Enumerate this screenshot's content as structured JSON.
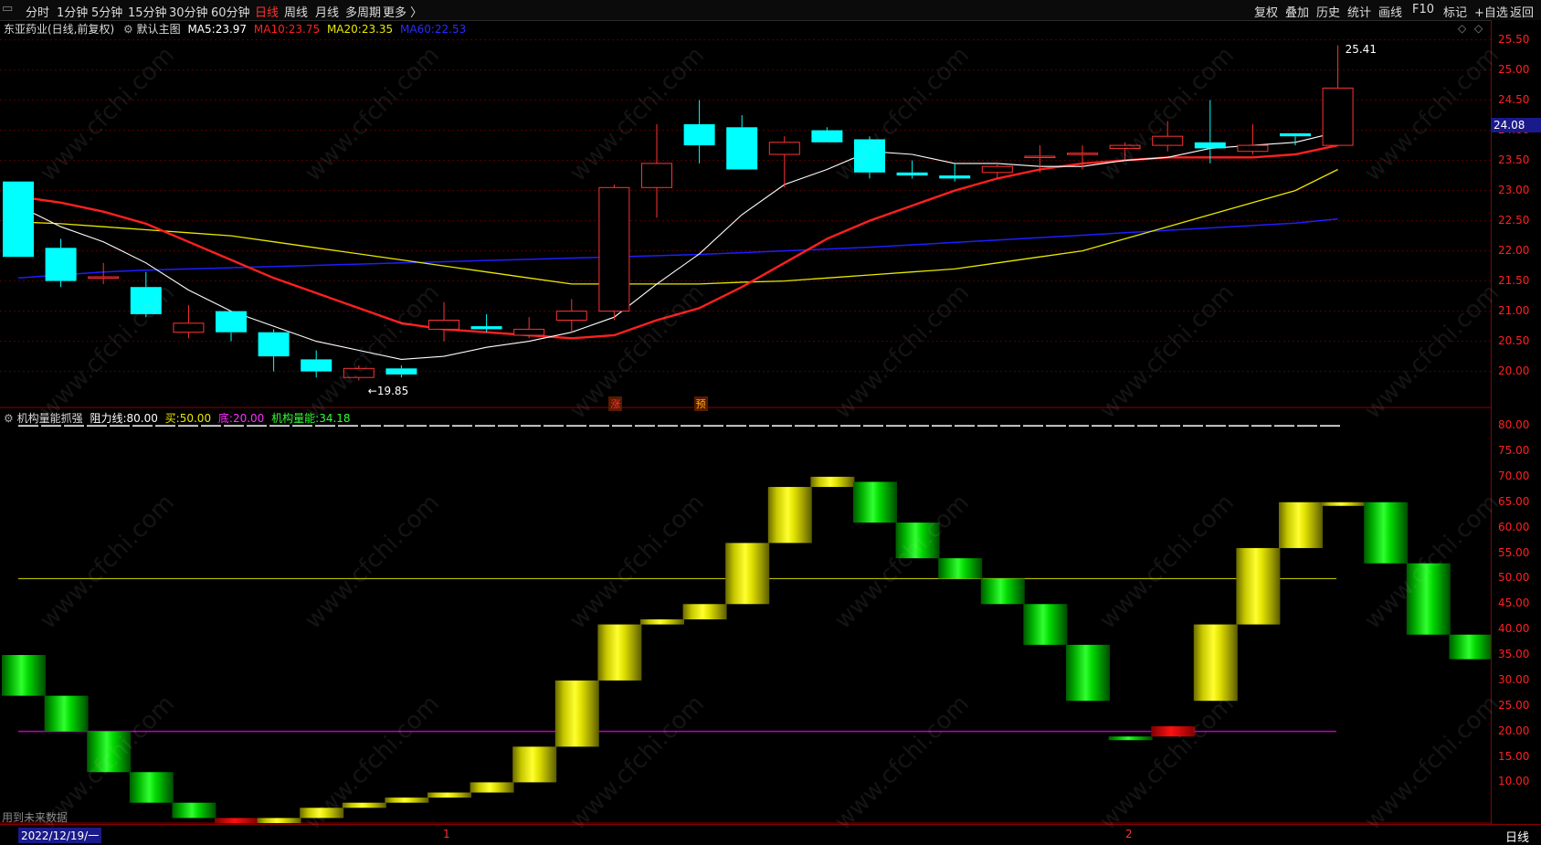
{
  "toolbar": {
    "left": [
      "分时",
      "1分钟",
      "5分钟",
      "15分钟",
      "30分钟",
      "60分钟",
      "日线",
      "周线",
      "月线",
      "多周期",
      "更多 〉"
    ],
    "active_index": 6,
    "right": [
      "复权",
      "叠加",
      "历史",
      "统计",
      "画线",
      "F10",
      "标记",
      "+自选",
      "返回"
    ]
  },
  "main_info": {
    "stock": "东亚药业(日线,前复权)",
    "chart_name": "默认主图",
    "ma5_label": "MA5:",
    "ma5_value": "23.97",
    "ma10_label": "MA10:",
    "ma10_value": "23.75",
    "ma20_label": "MA20:",
    "ma20_value": "23.35",
    "ma60_label": "MA60:",
    "ma60_value": "22.53"
  },
  "indicator_info": {
    "name": "机构量能抓强",
    "resist_label": "阻力线:",
    "resist_value": "80.00",
    "buy_label": "买:",
    "buy_value": "50.00",
    "bottom_label": "底:",
    "bottom_value": "20.00",
    "energy_label": "机构量能:",
    "energy_value": "34.18"
  },
  "price_ticks": [
    "25.50",
    "25.00",
    "24.50",
    "24.00",
    "23.50",
    "23.00",
    "22.50",
    "22.00",
    "21.50",
    "21.00",
    "20.50",
    "20.00"
  ],
  "indicator_ticks": [
    "80.00",
    "75.00",
    "70.00",
    "65.00",
    "60.00",
    "55.00",
    "50.00",
    "45.00",
    "40.00",
    "35.00",
    "30.00",
    "25.00",
    "20.00",
    "15.00",
    "10.00"
  ],
  "current_price": "24.08",
  "high_label": "25.41",
  "low_label": "←19.85",
  "markers": {
    "zhang": "涨",
    "yu": "预"
  },
  "bottom_note": "用到未来数据",
  "date_label": "2022/12/19/一",
  "month_marks": [
    "1",
    "2"
  ],
  "period_label": "日线",
  "watermark": "www.cfchi.com",
  "colors": {
    "up": "#ff3232",
    "down": "#00ffff",
    "ma5": "#ffffff",
    "ma10": "#ff2020",
    "ma20": "#e8e800",
    "ma60": "#1e1eff",
    "border": "#8b0000"
  },
  "chart_data": [
    {
      "type": "candlestick",
      "title": "东亚药业(日线,前复权)",
      "series": [
        {
          "open": 23.15,
          "close": 21.9,
          "high": 23.15,
          "low": 21.9
        },
        {
          "open": 22.05,
          "close": 21.5,
          "high": 22.2,
          "low": 21.4
        },
        {
          "open": 21.57,
          "close": 21.57,
          "high": 21.8,
          "low": 21.45
        },
        {
          "open": 21.4,
          "close": 20.95,
          "high": 21.65,
          "low": 20.9
        },
        {
          "open": 20.65,
          "close": 20.8,
          "high": 21.1,
          "low": 20.55
        },
        {
          "open": 21.0,
          "close": 20.65,
          "high": 21.0,
          "low": 20.5
        },
        {
          "open": 20.65,
          "close": 20.25,
          "high": 20.7,
          "low": 20.0
        },
        {
          "open": 20.2,
          "close": 20.0,
          "high": 20.35,
          "low": 19.9
        },
        {
          "open": 19.9,
          "close": 20.05,
          "high": 20.1,
          "low": 19.85
        },
        {
          "open": 20.05,
          "close": 19.95,
          "high": 20.1,
          "low": 19.9
        },
        {
          "open": 20.7,
          "close": 20.85,
          "high": 21.15,
          "low": 20.5
        },
        {
          "open": 20.75,
          "close": 20.7,
          "high": 20.95,
          "low": 20.65
        },
        {
          "open": 20.6,
          "close": 20.7,
          "high": 20.9,
          "low": 20.55
        },
        {
          "open": 20.85,
          "close": 21.0,
          "high": 21.2,
          "low": 20.65
        },
        {
          "open": 21.0,
          "close": 23.05,
          "high": 23.1,
          "low": 20.85
        },
        {
          "open": 23.05,
          "close": 23.45,
          "high": 24.1,
          "low": 22.55
        },
        {
          "open": 24.1,
          "close": 23.75,
          "high": 24.5,
          "low": 23.45
        },
        {
          "open": 24.05,
          "close": 23.35,
          "high": 24.25,
          "low": 23.35
        },
        {
          "open": 23.6,
          "close": 23.8,
          "high": 23.9,
          "low": 23.05
        },
        {
          "open": 24.0,
          "close": 23.8,
          "high": 24.05,
          "low": 23.8
        },
        {
          "open": 23.85,
          "close": 23.3,
          "high": 23.9,
          "low": 23.2
        },
        {
          "open": 23.3,
          "close": 23.25,
          "high": 23.5,
          "low": 23.2
        },
        {
          "open": 23.25,
          "close": 23.2,
          "high": 23.45,
          "low": 23.15
        },
        {
          "open": 23.3,
          "close": 23.4,
          "high": 23.45,
          "low": 23.2
        },
        {
          "open": 23.55,
          "close": 23.57,
          "high": 23.75,
          "low": 23.3
        },
        {
          "open": 23.6,
          "close": 23.62,
          "high": 23.75,
          "low": 23.35
        },
        {
          "open": 23.7,
          "close": 23.75,
          "high": 23.8,
          "low": 23.5
        },
        {
          "open": 23.75,
          "close": 23.9,
          "high": 24.15,
          "low": 23.65
        },
        {
          "open": 23.8,
          "close": 23.7,
          "high": 24.5,
          "low": 23.45
        },
        {
          "open": 23.65,
          "close": 23.75,
          "high": 24.1,
          "low": 23.6
        },
        {
          "open": 23.95,
          "close": 23.9,
          "high": 23.95,
          "low": 23.75
        },
        {
          "open": 23.75,
          "close": 24.7,
          "high": 25.41,
          "low": 23.75
        }
      ],
      "ma5": [
        22.75,
        22.4,
        22.15,
        21.8,
        21.35,
        21.0,
        20.75,
        20.5,
        20.35,
        20.2,
        20.25,
        20.4,
        20.5,
        20.65,
        20.9,
        21.45,
        21.95,
        22.6,
        23.1,
        23.35,
        23.65,
        23.6,
        23.45,
        23.45,
        23.4,
        23.4,
        23.5,
        23.55,
        23.7,
        23.75,
        23.8,
        23.97
      ],
      "ma10": [
        22.9,
        22.8,
        22.65,
        22.45,
        22.15,
        21.85,
        21.55,
        21.3,
        21.05,
        20.8,
        20.7,
        20.65,
        20.6,
        20.55,
        20.6,
        20.85,
        21.05,
        21.4,
        21.8,
        22.2,
        22.5,
        22.75,
        23.0,
        23.2,
        23.35,
        23.45,
        23.5,
        23.55,
        23.55,
        23.55,
        23.6,
        23.75
      ],
      "ma20": [
        22.48,
        22.45,
        22.4,
        22.35,
        22.3,
        22.25,
        22.15,
        22.05,
        21.95,
        21.85,
        21.75,
        21.65,
        21.55,
        21.45,
        21.45,
        21.45,
        21.45,
        21.48,
        21.5,
        21.55,
        21.6,
        21.65,
        21.7,
        21.8,
        21.9,
        22.0,
        22.2,
        22.4,
        22.6,
        22.8,
        23.0,
        23.35
      ],
      "ma60": [
        21.55,
        21.6,
        21.65,
        21.68,
        21.7,
        21.72,
        21.74,
        21.76,
        21.78,
        21.8,
        21.82,
        21.84,
        21.86,
        21.88,
        21.9,
        21.92,
        21.94,
        21.97,
        22.0,
        22.03,
        22.06,
        22.1,
        22.14,
        22.18,
        22.22,
        22.26,
        22.3,
        22.34,
        22.38,
        22.42,
        22.46,
        22.53
      ],
      "ylim": [
        19.6,
        25.6
      ]
    },
    {
      "type": "bar",
      "title": "机构量能抓强",
      "values": [
        35,
        27,
        20,
        12,
        6,
        3,
        3,
        5,
        6,
        7,
        8,
        10,
        17,
        30,
        41,
        42,
        45,
        57,
        68,
        70,
        61,
        54,
        50,
        45,
        37,
        26,
        19,
        21,
        41,
        56,
        65,
        65,
        53,
        39,
        34.18
      ],
      "lows": [
        27,
        20,
        12,
        6,
        3,
        2,
        2,
        3,
        5,
        6,
        7,
        8,
        10,
        17,
        30,
        41,
        42,
        45,
        57,
        68,
        69,
        61,
        54,
        50,
        45,
        37,
        19,
        19,
        26,
        41,
        56,
        65,
        65,
        53,
        39,
        34
      ],
      "phase": [
        "down",
        "down",
        "down",
        "down",
        "down",
        "red",
        "up",
        "up",
        "up",
        "up",
        "up",
        "up",
        "up",
        "up",
        "up",
        "up",
        "up",
        "up",
        "up",
        "up",
        "down",
        "down",
        "down",
        "down",
        "down",
        "down",
        "down",
        "red",
        "up",
        "up",
        "up",
        "up",
        "down",
        "down",
        "down"
      ],
      "lines": {
        "resist": 80,
        "buy": 50,
        "bottom": 20
      },
      "ylim": [
        2,
        82
      ]
    }
  ]
}
